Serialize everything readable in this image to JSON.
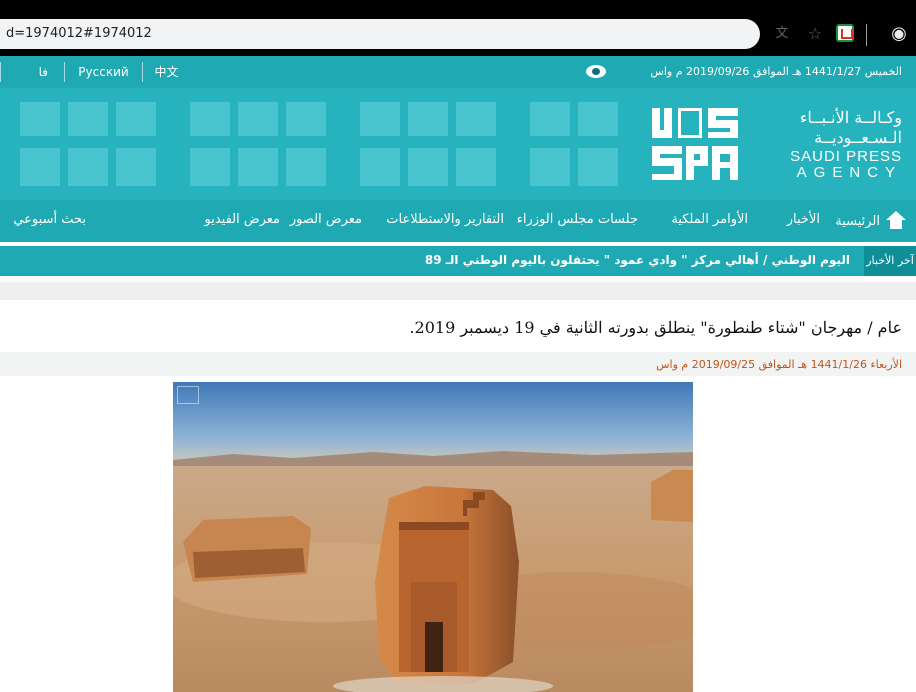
{
  "browser": {
    "url_fragment": "d=1974012#1974012",
    "icons": [
      "translate-icon",
      "star-icon",
      "extension-icon",
      "profile-icon"
    ]
  },
  "topbar": {
    "date_text": "الخميس 1441/1/27 هـ الموافق 2019/09/26 م واس",
    "languages": [
      "中文",
      "Русский",
      "فا"
    ]
  },
  "logo": {
    "arabic_line1": "وكـالــة الأنـبــاء",
    "arabic_line2": "الـسـعــوديــة",
    "english_line1": "SAUDI PRESS",
    "english_line2": "AGENCY"
  },
  "nav": {
    "items": [
      "الرئيسية",
      "الأخبار",
      "الأوامر الملكية",
      "جلسات مجلس الوزراء",
      "التقارير والاستطلاعات",
      "معرض الصور",
      "معرض الفيديو",
      "بحث أسبوعي"
    ]
  },
  "ticker": {
    "label": "آخر الأخبار",
    "headline": "اليوم الوطني / أهالي مركز \" وادي عمود \" يحتفلون باليوم الوطني الـ 89"
  },
  "article": {
    "title": "عام / مهرجان \"شتاء طنطورة\" ينطلق بدورته الثانية في 19 ديسمبر 2019.",
    "date": "الأربعاء 1441/1/26 هـ الموافق 2019/09/25 م واس"
  },
  "colors": {
    "brand_teal": "#1ea9b3",
    "banner_teal": "#26b3be",
    "date_orange": "#c1551b"
  }
}
